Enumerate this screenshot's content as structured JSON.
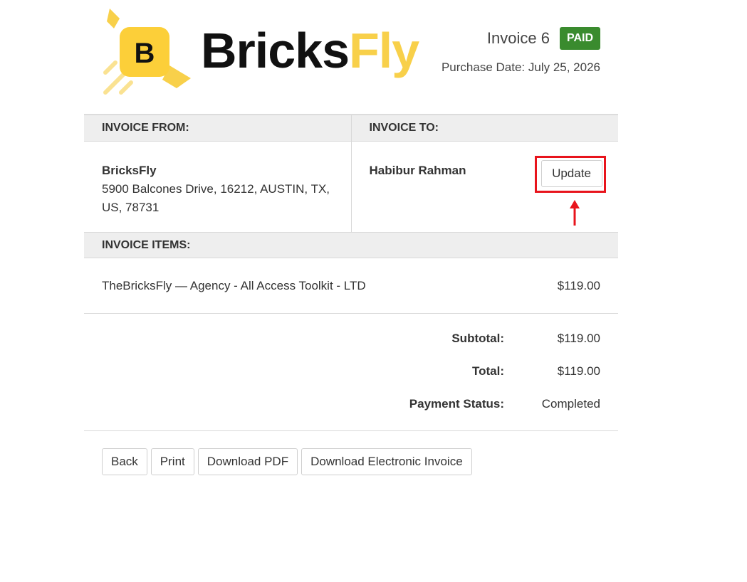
{
  "brand": {
    "logo_letter": "B",
    "name_part1": "Bricks",
    "name_part2": "Fly",
    "colors": {
      "accent": "#f8d04a",
      "dark": "#111111"
    }
  },
  "invoice": {
    "title": "Invoice 6",
    "status_badge": "PAID",
    "status_color": "#3a8b2e",
    "purchase_date": "Purchase Date: July 25, 2026"
  },
  "from": {
    "header": "INVOICE FROM:",
    "name": "BricksFly",
    "address_line1": "5900 Balcones Drive, 16212, AUSTIN, TX,",
    "address_line2": "US, 78731"
  },
  "to": {
    "header": "INVOICE TO:",
    "name": "Habibur Rahman",
    "update_label": "Update",
    "highlight_color": "#e8141c"
  },
  "items": {
    "header": "INVOICE ITEMS:",
    "rows": [
      {
        "name": "TheBricksFly — Agency - All Access Toolkit - LTD",
        "price": "$119.00"
      }
    ]
  },
  "totals": {
    "subtotal_label": "Subtotal:",
    "subtotal_value": "$119.00",
    "total_label": "Total:",
    "total_value": "$119.00",
    "payment_status_label": "Payment Status:",
    "payment_status_value": "Completed"
  },
  "actions": {
    "back": "Back",
    "print": "Print",
    "download_pdf": "Download PDF",
    "download_einvoice": "Download Electronic Invoice"
  }
}
